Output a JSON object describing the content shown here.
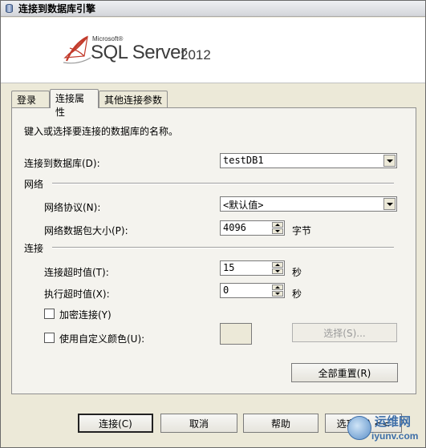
{
  "window": {
    "title": "连接到数据库引擎"
  },
  "banner": {
    "logo_microsoft": "Microsoft®",
    "logo_product": "SQL Server",
    "logo_version": "2012"
  },
  "tabs": [
    {
      "label": "登录"
    },
    {
      "label": "连接属性"
    },
    {
      "label": "其他连接参数"
    }
  ],
  "panel": {
    "instruction": "键入或选择要连接的数据库的名称。",
    "database": {
      "label": "连接到数据库(D):",
      "value": "testDB1"
    },
    "network_section": "网络",
    "network_protocol": {
      "label": "网络协议(N):",
      "value": "<默认值>"
    },
    "packet_size": {
      "label": "网络数据包大小(P):",
      "value": "4096",
      "unit": "字节"
    },
    "connection_section": "连接",
    "connect_timeout": {
      "label": "连接超时值(T):",
      "value": "15",
      "unit": "秒"
    },
    "exec_timeout": {
      "label": "执行超时值(X):",
      "value": "0",
      "unit": "秒"
    },
    "encrypt": {
      "label": "加密连接(Y)",
      "checked": false
    },
    "custom_color": {
      "label": "使用自定义颜色(U):",
      "checked": false
    },
    "select_button": "选择(S)...",
    "reset_button": "全部重置(R)"
  },
  "buttons": {
    "connect": "连接(C)",
    "cancel": "取消",
    "help": "帮助",
    "options": "选项(O) <<"
  },
  "watermark": {
    "line1": "运维网",
    "line2": "iyunv.com"
  }
}
